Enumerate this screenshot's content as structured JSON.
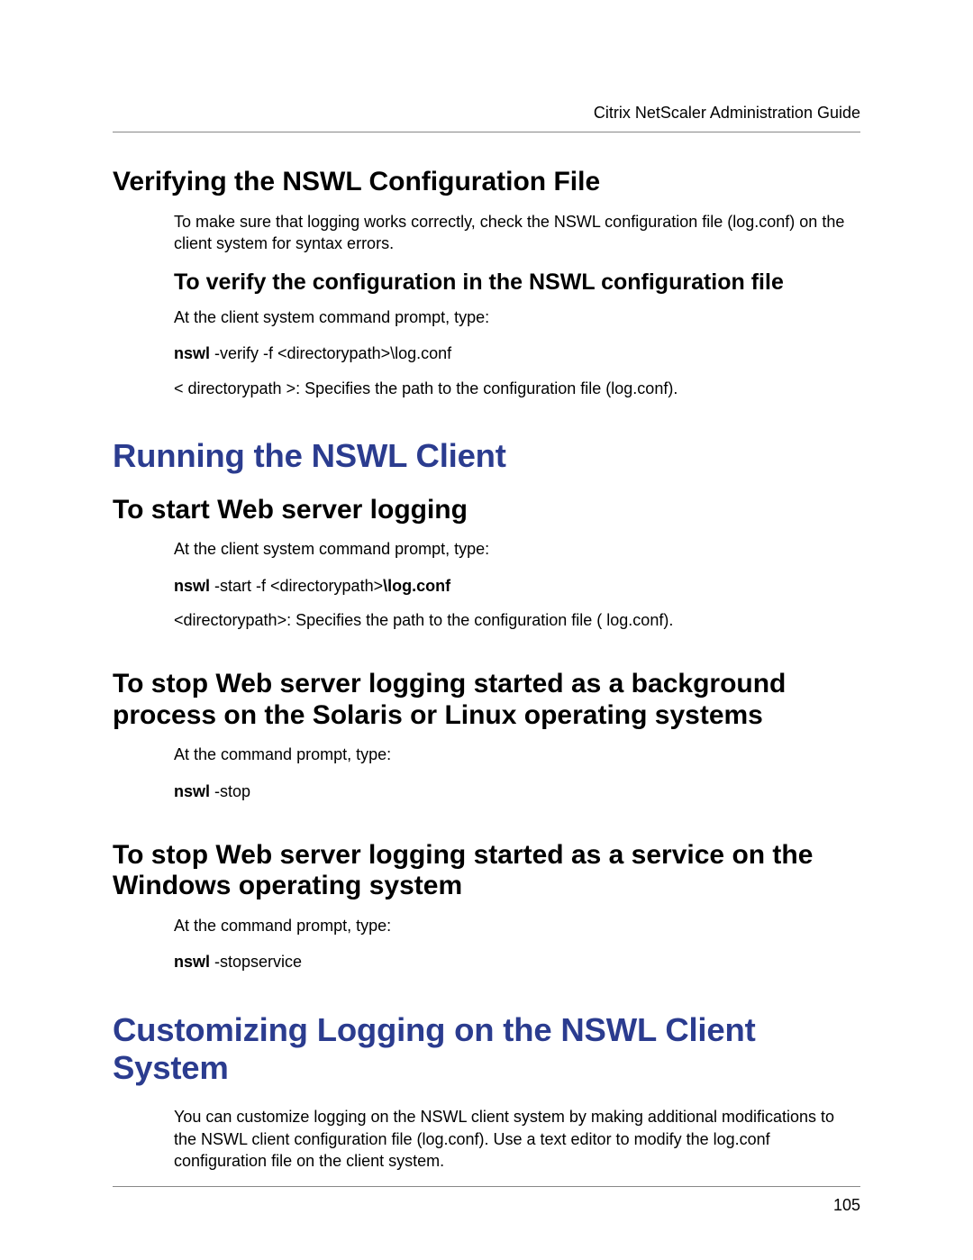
{
  "header": "Citrix NetScaler Administration Guide",
  "page_number": "105",
  "section1": {
    "title": "Verifying the NSWL Configuration File",
    "intro": "To make sure that logging works correctly, check the NSWL configuration file (log.conf) on the client system for syntax errors.",
    "sub": {
      "title": "To verify the configuration in the NSWL configuration file",
      "p1": "At the client system command prompt, type:",
      "cmd_bold": "nswl",
      "cmd_rest": " -verify -f <directorypath>\\log.conf",
      "p2": "< directorypath >: Specifies the path to the configuration file (log.conf)."
    }
  },
  "section2": {
    "title": "Running the NSWL Client",
    "sub1": {
      "title": "To start Web server logging",
      "p1": "At the client system command prompt, type:",
      "cmd_bold1": "nswl",
      "cmd_mid": " -start -f <directorypath>",
      "cmd_bold2": "\\log.conf",
      "p2": "<directorypath>: Specifies the path to the configuration file ( log.conf)."
    },
    "sub2": {
      "title": "To stop Web server logging started as a background process on the Solaris or Linux operating systems",
      "p1": "At the command prompt, type:",
      "cmd_bold": "nswl",
      "cmd_rest": " -stop"
    },
    "sub3": {
      "title": "To stop Web server logging started as a service on the Windows operating system",
      "p1": "At the command prompt, type:",
      "cmd_bold": "nswl",
      "cmd_rest": " -stopservice"
    }
  },
  "section3": {
    "title": "Customizing Logging on the NSWL Client System",
    "intro": "You can customize logging on the NSWL client system by making additional modifications to the NSWL client configuration file (log.conf). Use a text editor to modify the log.conf configuration file on the client system."
  }
}
